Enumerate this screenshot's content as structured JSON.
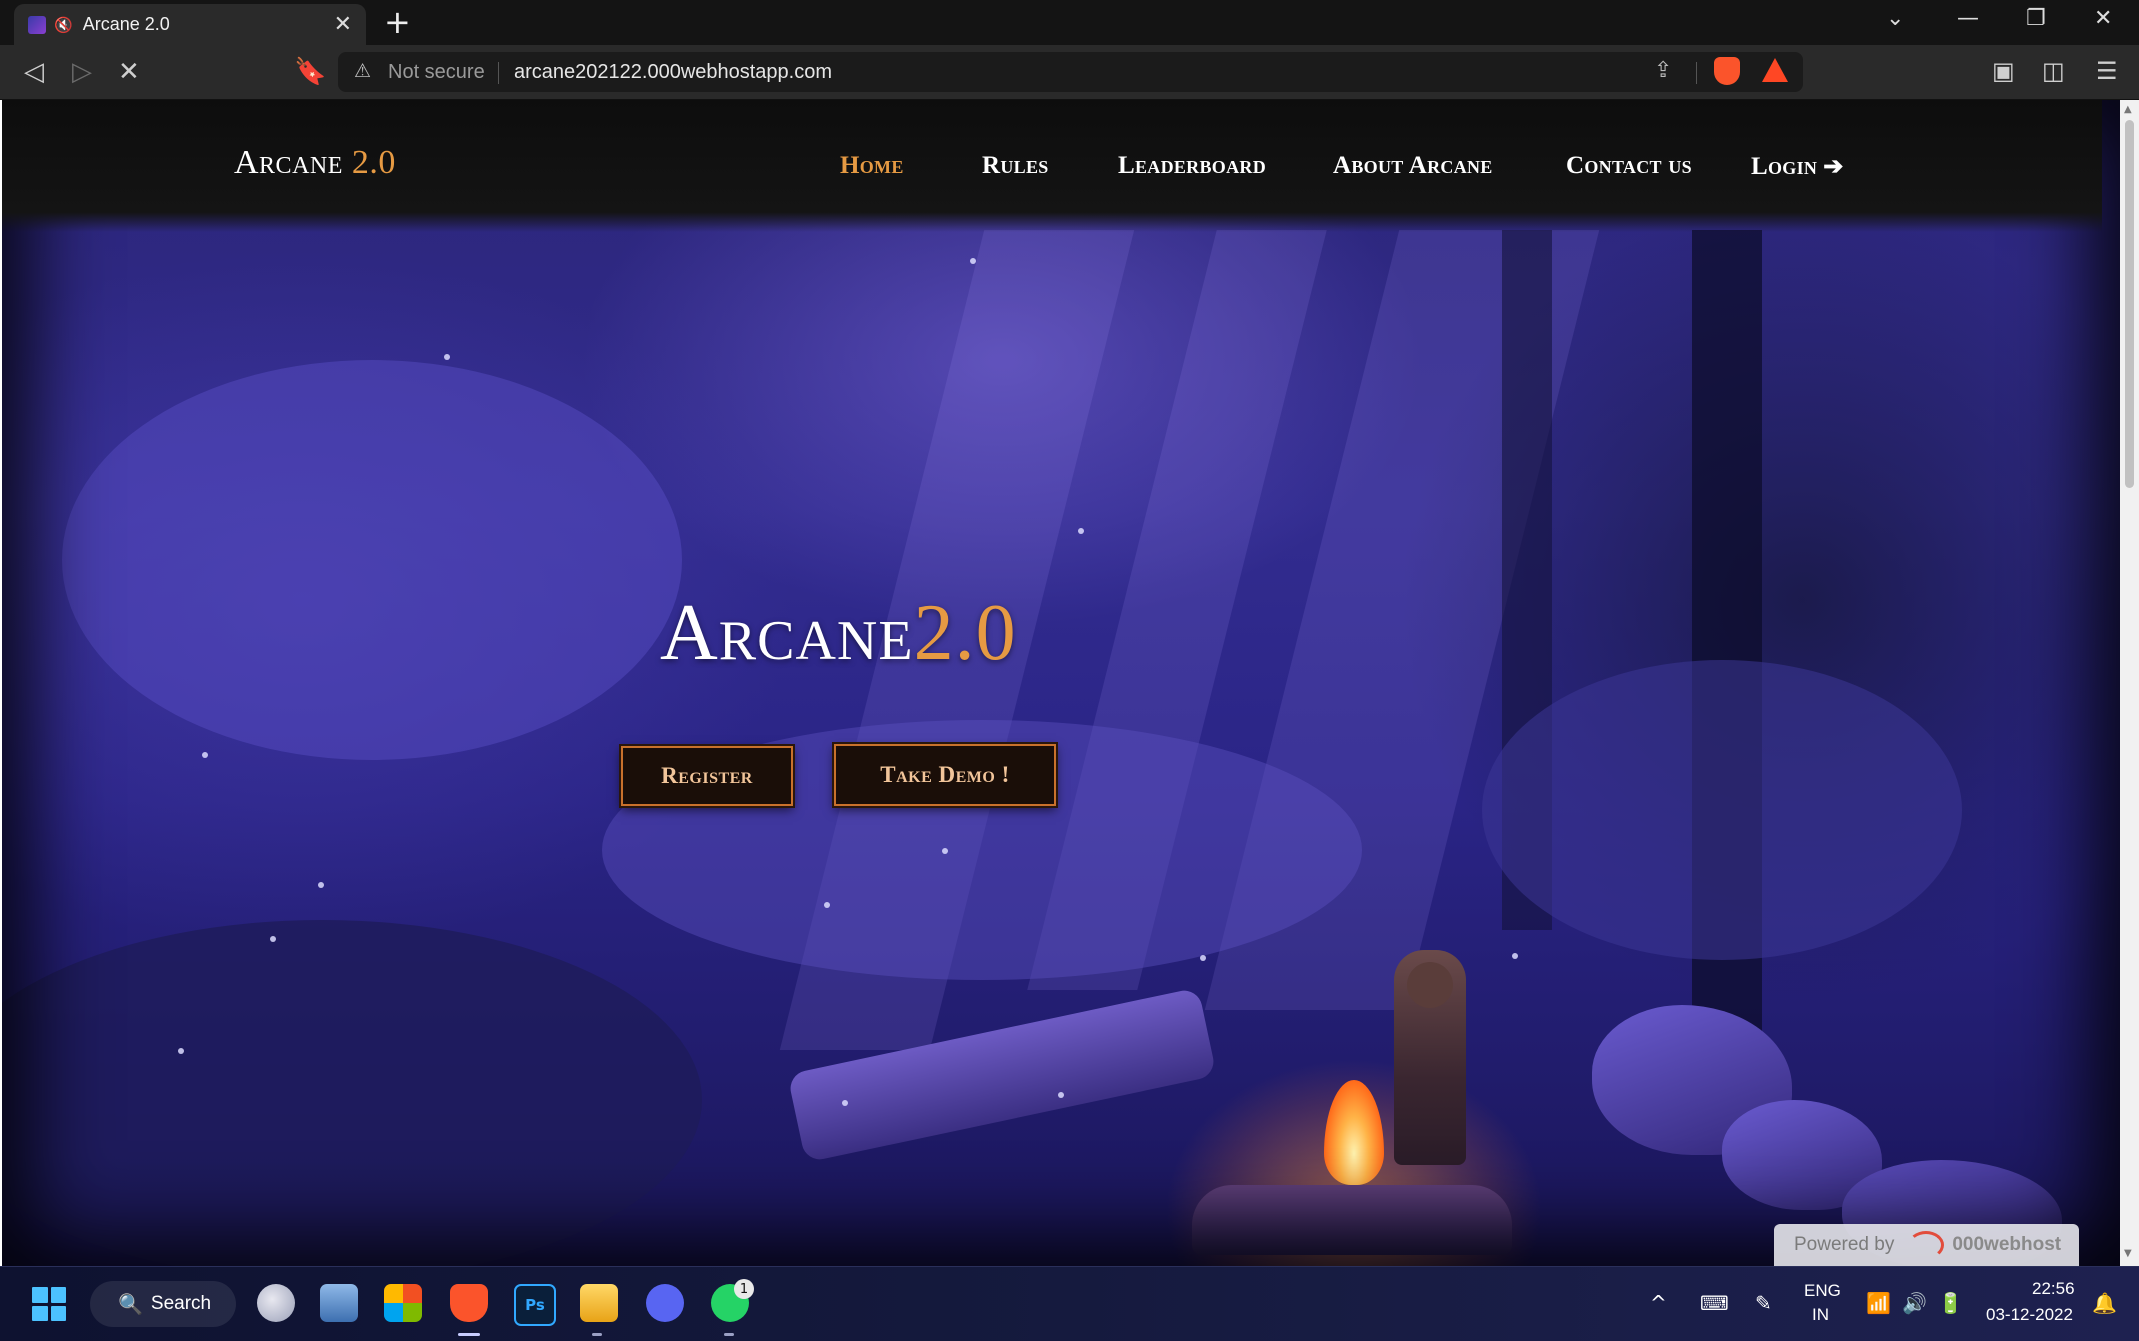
{
  "browser": {
    "tab_title": "Arcane 2.0",
    "new_tab_symbol": "+",
    "security_label": "Not secure",
    "url": "arcane202122.000webhostapp.com"
  },
  "site": {
    "brand_name": "Arcane",
    "brand_version": "2.0",
    "nav": {
      "home": "Home",
      "rules": "Rules",
      "leaderboard": "Leaderboard",
      "about": "About Arcane",
      "contact": "Contact us",
      "login": "Login"
    },
    "hero": {
      "title": "Arcane",
      "version": "2.0",
      "register_label": "Register",
      "demo_label": "Take Demo !"
    },
    "powered_by": {
      "prefix": "Powered by",
      "host": "000webhost"
    },
    "accent_color": "#e69a43"
  },
  "taskbar": {
    "search_label": "Search",
    "whatsapp_badge": "1",
    "lang_top": "ENG",
    "lang_bottom": "IN",
    "time": "22:56",
    "date": "03-12-2022"
  },
  "icons": [
    "mute-icon",
    "close-icon",
    "back-icon",
    "forward-icon",
    "stop-icon",
    "bookmark-icon",
    "warning-icon",
    "share-icon",
    "brave-shields-icon",
    "brave-rewards-icon",
    "sidebar-icon",
    "wallet-icon",
    "menu-icon",
    "login-arrow-icon",
    "windows-start-icon",
    "search-icon",
    "weather-icon",
    "photos-icon",
    "store-icon",
    "brave-app-icon",
    "photoshop-icon",
    "explorer-icon",
    "discord-icon",
    "whatsapp-icon",
    "chevron-up-icon",
    "keyboard-icon",
    "pen-icon",
    "wifi-icon",
    "volume-icon",
    "battery-icon",
    "notification-icon"
  ]
}
